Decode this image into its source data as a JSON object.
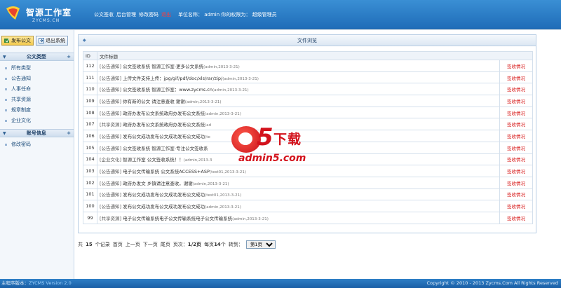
{
  "header": {
    "logo_title": "智源工作室",
    "logo_sub": "ZYCMS.CN",
    "nav": [
      {
        "label": "公文签收",
        "name": "nav-receive"
      },
      {
        "label": "后台管理",
        "name": "nav-admin"
      },
      {
        "label": "修改密码",
        "name": "nav-change-password"
      }
    ],
    "logout": "退出",
    "user_info": "单位名称： admin 你的权限为： 超级管理员"
  },
  "sidebar": {
    "publish_button": "发布公文",
    "exit_button": "退出系统",
    "section1_title": "公文类型",
    "section1_items": [
      "所有类型",
      "公告通知",
      "人事任命",
      "共享资源",
      "规章制度",
      "企业文化"
    ],
    "section2_title": "账号信息",
    "section2_items": [
      "修改密码"
    ]
  },
  "panel": {
    "title": "文件浏览",
    "col_id": "ID",
    "col_title": "文件标题",
    "rows": [
      {
        "id": "112",
        "cat": "[公告通知]",
        "title": "公文签收系统 智源工作室-更多公文系统",
        "meta": "(admin,2013-3-21)",
        "action": "签收情况"
      },
      {
        "id": "111",
        "cat": "[公告通知]",
        "title": "上传文件支持上传：jpg/gif/pdf/doc/xls/rar/zip/",
        "meta": "(admin,2013-3-21)",
        "action": "签收情况"
      },
      {
        "id": "110",
        "cat": "[公告通知]",
        "title": "公文签收系统 智源工作室：www.zycms.cn",
        "meta": "(admin,2013-3-21)",
        "action": "签收情况"
      },
      {
        "id": "109",
        "cat": "[公告通知]",
        "title": "你有新的公文 请注意查收 谢谢",
        "meta": "(admin,2013-3-21)",
        "action": "签收情况"
      },
      {
        "id": "108",
        "cat": "[公告通知]",
        "title": "政府办发布公文系统政府办发布公文系统",
        "meta": "(admin,2013-3-21)",
        "action": "签收情况"
      },
      {
        "id": "107",
        "cat": "[共享资源]",
        "title": "政府办发布公文系统政府办发布公文系统",
        "meta": "(ad",
        "action": "签收情况"
      },
      {
        "id": "106",
        "cat": "[公告通知]",
        "title": "发布公文成功发布公文成功发布公文成功",
        "meta": "(te",
        "action": "签收情况"
      },
      {
        "id": "105",
        "cat": "[公告通知]",
        "title": "公文签收系统 智源工作室-专注公文签收系",
        "meta": "",
        "action": "签收情况"
      },
      {
        "id": "104",
        "cat": "[企业文化]",
        "title": "智源工作室 公文签收系统！！",
        "meta": "(admin,2013-3",
        "action": "签收情况"
      },
      {
        "id": "103",
        "cat": "[公告通知]",
        "title": "电子公文传输系统 公文系统ACCESS+ASP",
        "meta": "(test01,2013-3-21)",
        "action": "签收情况"
      },
      {
        "id": "102",
        "cat": "[公告通知]",
        "title": "政府办发文 乡镇请注意查收，谢谢",
        "meta": "(admin,2013-3-21)",
        "action": "签收情况"
      },
      {
        "id": "101",
        "cat": "[公告通知]",
        "title": "发布公文成功发布公文成功发布公文成功",
        "meta": "(test01,2013-3-21)",
        "action": "签收情况"
      },
      {
        "id": "100",
        "cat": "[公告通知]",
        "title": "发布公文成功发布公文成功发布公文成功",
        "meta": "(admin,2013-3-21)",
        "action": "签收情况"
      },
      {
        "id": "99",
        "cat": "[共享资源]",
        "title": "电子公文传输系统电子公文传输系统电子公文传输系统",
        "meta": "(admin,2013-3-21)",
        "action": "签收情况"
      }
    ]
  },
  "pager": {
    "total_prefix": "共",
    "total": "15",
    "total_suffix": "个记录",
    "first": "首页",
    "prev": "上一页",
    "next": "下一页",
    "last": "尾页",
    "page_label": "页次：",
    "page_value": "1/2页",
    "per_page_prefix": "每页",
    "per_page": "14",
    "per_page_suffix": "个",
    "goto_label": "转到：",
    "goto_selected": "第1页"
  },
  "watermark": {
    "big": "5",
    "download": "下载",
    "url": "admin5.com"
  },
  "footer": {
    "left_label": "主程序版本：",
    "version": "ZYCMS Version 2.0",
    "copyright": "Copyright © 2010 - 2013 Zycms.Com All Rights Reserved"
  },
  "colors": {
    "header_blue": "#1f6cb8",
    "action_red": "#d71a1a",
    "logout_red": "#ff3b3b"
  }
}
